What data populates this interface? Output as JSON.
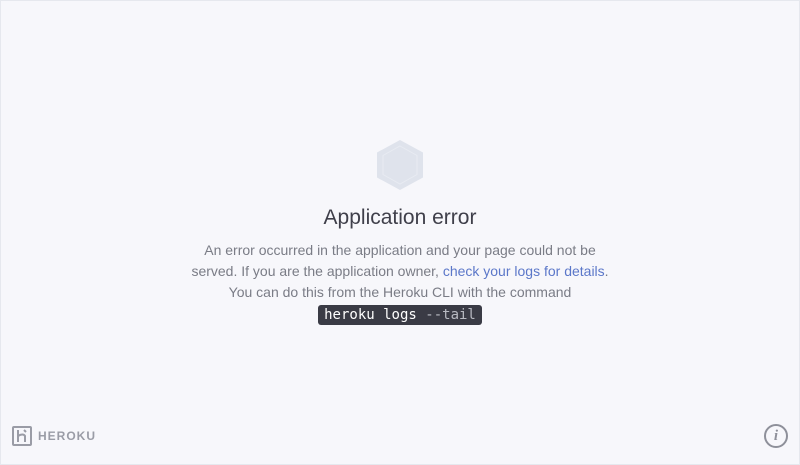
{
  "error": {
    "title": "Application error",
    "message_line1": "An error occurred in the application and your page could not be",
    "message_line2_prefix": "served. If you are the application owner, ",
    "logs_link": "check your logs for details",
    "message_line2_suffix": ".",
    "message_line3": "You can do this from the Heroku CLI with the command",
    "command_main": "heroku logs ",
    "command_flag": "--tail"
  },
  "footer": {
    "logo_text": "HEROKU",
    "info_glyph": "i"
  },
  "icons": {
    "error": "hexagon-icon",
    "logo": "heroku-logo-icon",
    "info": "info-icon"
  },
  "colors": {
    "background": "#f7f7fb",
    "link": "#5b77c9",
    "command_bg": "#3a3b45",
    "hexagon": "#dfe3ec"
  }
}
